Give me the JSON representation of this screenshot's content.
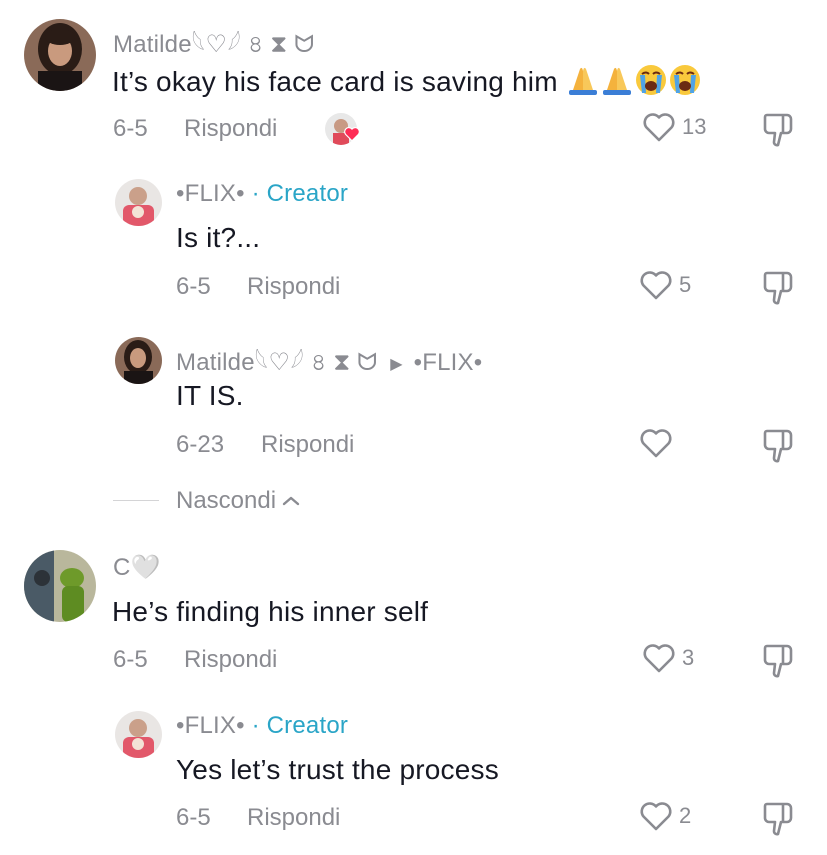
{
  "comments": [
    {
      "username": "Matilde𓆩♡𓆪 ৪ ⧗ ᗢ",
      "text": "It’s okay his face card is saving him",
      "emojis": [
        "pray-emoji",
        "pray-emoji",
        "crying-face-emoji",
        "crying-face-emoji"
      ],
      "date": "6-5",
      "reply_label": "Rispondi",
      "likes": "13",
      "liked_by_creator": true,
      "replies": [
        {
          "username": "•FLIX•",
          "badge": "· Creator",
          "text": "Is it?...",
          "date": "6-5",
          "reply_label": "Rispondi",
          "likes": "5"
        },
        {
          "username": "Matilde𓆩♡𓆪 ৪ ⧗ ᗢ",
          "reply_to": "•FLIX•",
          "text": "IT IS.",
          "date": "6-23",
          "reply_label": "Rispondi",
          "likes": ""
        }
      ],
      "hide_label": "Nascondi"
    },
    {
      "username": "C🤍",
      "text": "He’s finding his inner self",
      "date": "6-5",
      "reply_label": "Rispondi",
      "likes": "3",
      "replies": [
        {
          "username": "•FLIX•",
          "badge": "· Creator",
          "text": "Yes let’s trust the process",
          "date": "6-5",
          "reply_label": "Rispondi",
          "likes": "2"
        }
      ]
    }
  ],
  "colors": {
    "text": "#161823",
    "muted": "#8a8b91",
    "creator": "#2aa5c7",
    "heart": "#fe2c55"
  }
}
